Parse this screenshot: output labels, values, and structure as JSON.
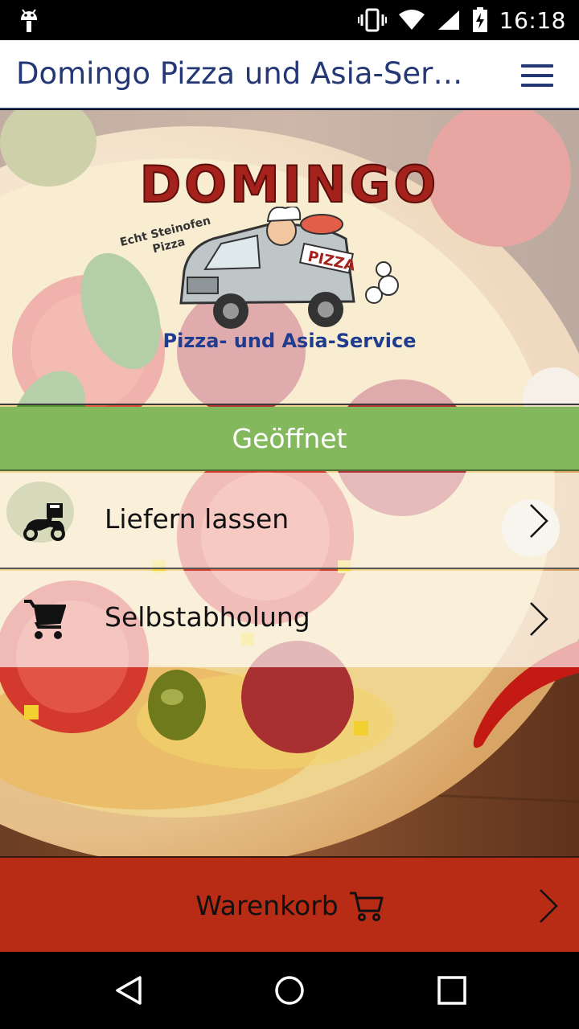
{
  "status_bar": {
    "time": "16:18",
    "icons": [
      "android-icon",
      "vibrate-icon",
      "wifi-icon",
      "signal-icon",
      "battery-charging-icon"
    ]
  },
  "app_bar": {
    "title": "Domingo Pizza und Asia-Servi...",
    "menu_icon": "hamburger-menu-icon"
  },
  "logo": {
    "wordmark": "DOMINGO",
    "tagline_line1": "Echt Steinofen",
    "tagline_line2": "Pizza",
    "van_sign": "PIZZA",
    "subtitle": "Pizza- und Asia-Service"
  },
  "status": {
    "label": "Geöffnet",
    "color": "#84b85c"
  },
  "options": [
    {
      "label": "Liefern lassen",
      "icon": "delivery-scooter-icon"
    },
    {
      "label": "Selbstabholung",
      "icon": "shopping-cart-icon"
    }
  ],
  "cart": {
    "label": "Warenkorb",
    "icon": "cart-outline-icon",
    "color": "#b82b15"
  },
  "nav_bar": {
    "buttons": [
      "back-icon",
      "home-icon",
      "recents-icon"
    ]
  }
}
